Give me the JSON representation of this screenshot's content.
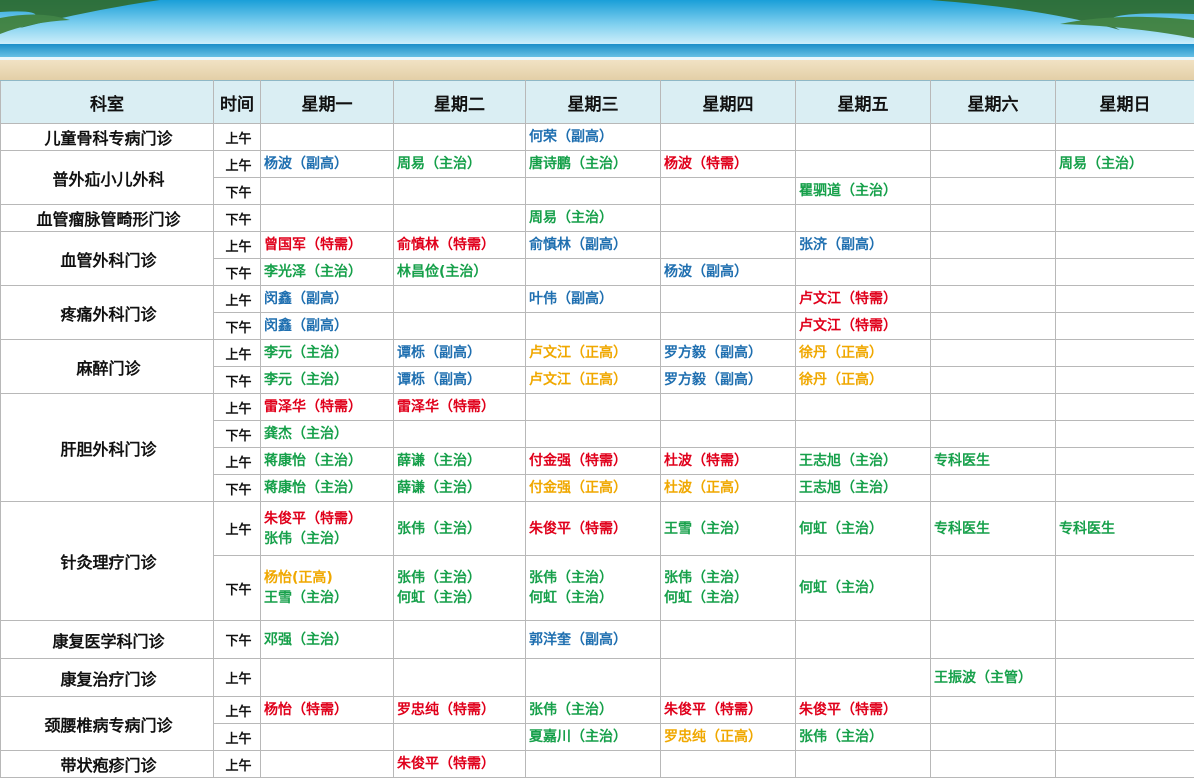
{
  "colors": {
    "blue": "#1f6fb0",
    "green": "#16a04a",
    "red": "#e0001b",
    "orange": "#f0a800",
    "header_bg": "#daeef3"
  },
  "headers": [
    "科室",
    "时间",
    "星期一",
    "星期二",
    "星期三",
    "星期四",
    "星期五",
    "星期六",
    "星期日"
  ],
  "departments": [
    {
      "name": "儿童骨科专病门诊",
      "rows": [
        {
          "time": "上午",
          "cells": [
            [],
            [],
            [
              [
                "何荣（副高）",
                "blue"
              ]
            ],
            [],
            [],
            [],
            []
          ]
        }
      ]
    },
    {
      "name": "普外疝小儿外科",
      "rows": [
        {
          "time": "上午",
          "cells": [
            [
              [
                "杨波（副高）",
                "blue"
              ]
            ],
            [
              [
                "周易（主治）",
                "green"
              ]
            ],
            [
              [
                "唐诗鹏（主治）",
                "green"
              ]
            ],
            [
              [
                "杨波（特需）",
                "red"
              ]
            ],
            [],
            [],
            [
              [
                "周易（主治）",
                "green"
              ]
            ]
          ]
        },
        {
          "time": "下午",
          "cells": [
            [],
            [],
            [],
            [],
            [
              [
                "瞿驷道（主治）",
                "green"
              ]
            ],
            [],
            []
          ]
        }
      ]
    },
    {
      "name": "血管瘤脉管畸形门诊",
      "rows": [
        {
          "time": "下午",
          "cells": [
            [],
            [],
            [
              [
                "周易（主治）",
                "green"
              ]
            ],
            [],
            [],
            [],
            []
          ]
        }
      ]
    },
    {
      "name": "血管外科门诊",
      "rows": [
        {
          "time": "上午",
          "cells": [
            [
              [
                "曾国军（特需）",
                "red"
              ]
            ],
            [
              [
                "俞慎林（特需）",
                "red"
              ]
            ],
            [
              [
                "俞慎林（副高）",
                "blue"
              ]
            ],
            [],
            [
              [
                "张济（副高）",
                "blue"
              ]
            ],
            [],
            []
          ]
        },
        {
          "time": "下午",
          "cells": [
            [
              [
                "李光泽（主治）",
                "green"
              ]
            ],
            [
              [
                "林昌俭(主治）",
                "green"
              ]
            ],
            [],
            [
              [
                "杨波（副高）",
                "blue"
              ]
            ],
            [],
            [],
            []
          ]
        }
      ]
    },
    {
      "name": "疼痛外科门诊",
      "rows": [
        {
          "time": "上午",
          "cells": [
            [
              [
                "闵鑫（副高）",
                "blue"
              ]
            ],
            [],
            [
              [
                "叶伟（副高）",
                "blue"
              ]
            ],
            [],
            [
              [
                "卢文江（特需）",
                "red"
              ]
            ],
            [],
            []
          ]
        },
        {
          "time": "下午",
          "cells": [
            [
              [
                "闵鑫（副高）",
                "blue"
              ]
            ],
            [],
            [],
            [],
            [
              [
                "卢文江（特需）",
                "red"
              ]
            ],
            [],
            []
          ]
        }
      ]
    },
    {
      "name": "麻醉门诊",
      "rows": [
        {
          "time": "上午",
          "cells": [
            [
              [
                "李元（主治）",
                "green"
              ]
            ],
            [
              [
                "谭栎（副高）",
                "blue"
              ]
            ],
            [
              [
                "卢文江（正高）",
                "orange"
              ]
            ],
            [
              [
                "罗方毅（副高）",
                "blue"
              ]
            ],
            [
              [
                "徐丹（正高）",
                "orange"
              ]
            ],
            [],
            []
          ]
        },
        {
          "time": "下午",
          "cells": [
            [
              [
                "李元（主治）",
                "green"
              ]
            ],
            [
              [
                "谭栎（副高）",
                "blue"
              ]
            ],
            [
              [
                "卢文江（正高）",
                "orange"
              ]
            ],
            [
              [
                "罗方毅（副高）",
                "blue"
              ]
            ],
            [
              [
                "徐丹（正高）",
                "orange"
              ]
            ],
            [],
            []
          ]
        }
      ]
    },
    {
      "name": "肝胆外科门诊",
      "rows": [
        {
          "time": "上午",
          "cells": [
            [
              [
                "雷泽华（特需）",
                "red"
              ]
            ],
            [
              [
                "雷泽华（特需）",
                "red"
              ]
            ],
            [],
            [],
            [],
            [],
            []
          ]
        },
        {
          "time": "下午",
          "cells": [
            [
              [
                "龚杰（主治）",
                "green"
              ]
            ],
            [],
            [],
            [],
            [],
            [],
            []
          ]
        },
        {
          "time": "上午",
          "cells": [
            [
              [
                "蒋康怡（主治）",
                "green"
              ]
            ],
            [
              [
                "薛谦（主治）",
                "green"
              ]
            ],
            [
              [
                "付金强（特需）",
                "red"
              ]
            ],
            [
              [
                "杜波（特需）",
                "red"
              ]
            ],
            [
              [
                "王志旭（主治）",
                "green"
              ]
            ],
            [
              [
                "专科医生",
                "green"
              ]
            ],
            []
          ]
        },
        {
          "time": "下午",
          "cells": [
            [
              [
                "蒋康怡（主治）",
                "green"
              ]
            ],
            [
              [
                "薛谦（主治）",
                "green"
              ]
            ],
            [
              [
                "付金强（正高）",
                "orange"
              ]
            ],
            [
              [
                "杜波（正高）",
                "orange"
              ]
            ],
            [
              [
                "王志旭（主治）",
                "green"
              ]
            ],
            [],
            []
          ]
        }
      ]
    },
    {
      "name": "针灸理疗门诊",
      "rows": [
        {
          "time": "上午",
          "cells": [
            [
              [
                "朱俊平（特需）",
                "red"
              ],
              [
                "张伟（主治）",
                "green"
              ]
            ],
            [
              [
                "张伟（主治）",
                "green"
              ]
            ],
            [
              [
                "朱俊平（特需）",
                "red"
              ]
            ],
            [
              [
                "王雪（主治）",
                "green"
              ]
            ],
            [
              [
                "何虹（主治）",
                "green"
              ]
            ],
            [
              [
                "专科医生",
                "green"
              ]
            ],
            [
              [
                "专科医生",
                "green"
              ]
            ]
          ]
        },
        {
          "time": "下午",
          "cells": [
            [
              [
                "杨怡(正高)",
                "orange"
              ],
              [
                "王雪（主治）",
                "green"
              ]
            ],
            [
              [
                "张伟（主治）",
                "green"
              ],
              [
                "何虹（主治）",
                "green"
              ]
            ],
            [
              [
                "张伟（主治）",
                "green"
              ],
              [
                "何虹（主治）",
                "green"
              ]
            ],
            [
              [
                "张伟（主治）",
                "green"
              ],
              [
                "何虹（主治）",
                "green"
              ]
            ],
            [
              [
                "何虹（主治）",
                "green"
              ]
            ],
            [],
            []
          ]
        }
      ]
    },
    {
      "name": "康复医学科门诊",
      "rows": [
        {
          "time": "下午",
          "cells": [
            [
              [
                "邓强（主治）",
                "green"
              ]
            ],
            [],
            [
              [
                "郭洋奎（副高）",
                "blue"
              ]
            ],
            [],
            [],
            [],
            []
          ]
        }
      ]
    },
    {
      "name": "康复治疗门诊",
      "rows": [
        {
          "time": "上午",
          "cells": [
            [],
            [],
            [],
            [],
            [],
            [
              [
                "王振波（主管）",
                "green"
              ]
            ],
            []
          ]
        }
      ]
    },
    {
      "name": "颈腰椎病专病门诊",
      "rows": [
        {
          "time": "上午",
          "cells": [
            [
              [
                "杨怡（特需）",
                "red"
              ]
            ],
            [
              [
                "罗忠纯（特需）",
                "red"
              ]
            ],
            [
              [
                "张伟（主治）",
                "green"
              ]
            ],
            [
              [
                "朱俊平（特需）",
                "red"
              ]
            ],
            [
              [
                "朱俊平（特需）",
                "red"
              ]
            ],
            [],
            []
          ]
        },
        {
          "time": "上午",
          "cells": [
            [],
            [],
            [
              [
                "夏嘉川（主治）",
                "green"
              ]
            ],
            [
              [
                "罗忠纯（正高）",
                "orange"
              ]
            ],
            [
              [
                "张伟（主治）",
                "green"
              ]
            ],
            [],
            []
          ]
        }
      ]
    },
    {
      "name": "带状疱疹门诊",
      "rows": [
        {
          "time": "上午",
          "cells": [
            [],
            [
              [
                "朱俊平（特需）",
                "red"
              ]
            ],
            [],
            [],
            [],
            [],
            []
          ]
        }
      ]
    }
  ]
}
